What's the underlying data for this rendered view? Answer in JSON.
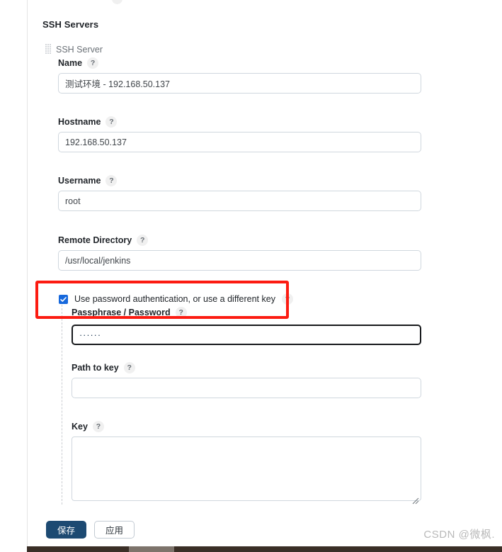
{
  "section": {
    "title": "SSH Servers",
    "entry_label": "SSH Server",
    "drag_handle_icon": "drag-handle-icon"
  },
  "help_glyph": "?",
  "fields": [
    {
      "key": "name",
      "label": "Name",
      "value": "测试环境 - 192.168.50.137",
      "placeholder": ""
    },
    {
      "key": "hostname",
      "label": "Hostname",
      "value": "192.168.50.137",
      "placeholder": ""
    },
    {
      "key": "username",
      "label": "Username",
      "value": "root",
      "placeholder": ""
    },
    {
      "key": "remote_directory",
      "label": "Remote Directory",
      "value": "/usr/local/jenkins",
      "placeholder": ""
    },
    {
      "key": "passphrase",
      "label": "Passphrase / Password",
      "value": "······",
      "placeholder": ""
    },
    {
      "key": "path_to_key",
      "label": "Path to key",
      "value": "",
      "placeholder": ""
    },
    {
      "key": "key",
      "label": "Key",
      "value": "",
      "placeholder": ""
    }
  ],
  "checkbox": {
    "label": "Use password authentication, or use a different key",
    "checked": true,
    "accent": "#1668dc"
  },
  "annotation": {
    "color": "#fc1b11"
  },
  "buttons": {
    "save": "保存",
    "apply": "应用"
  },
  "watermark": "CSDN @微枫."
}
